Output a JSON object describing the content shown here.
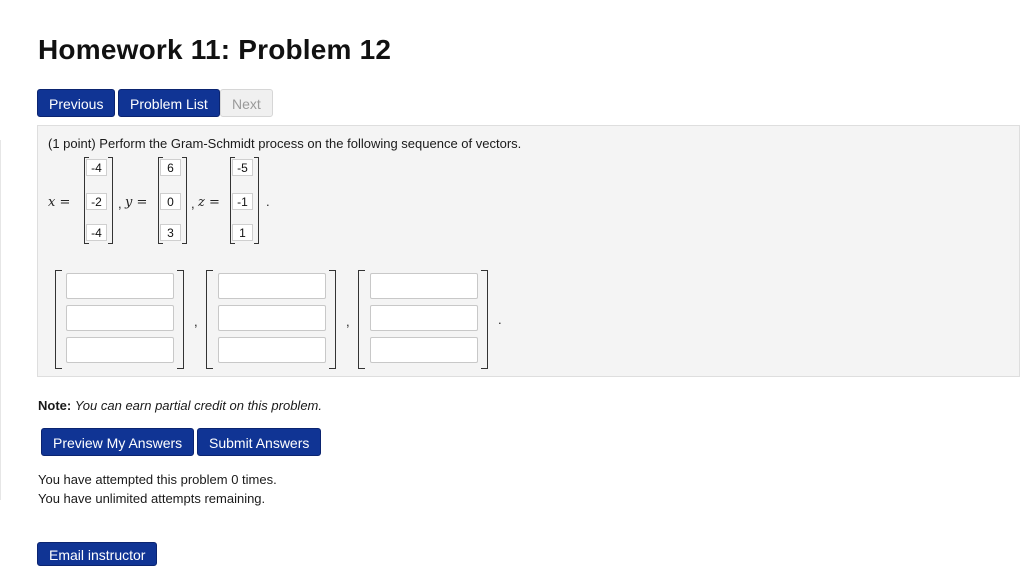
{
  "page": {
    "title": "Homework 11: Problem 12"
  },
  "nav": {
    "previous": "Previous",
    "problem_list": "Problem List",
    "next": "Next"
  },
  "problem": {
    "prompt": "(1 point) Perform the Gram-Schmidt process on the following sequence of vectors.",
    "vectors": [
      {
        "name": "x =",
        "values": [
          "-4",
          "-2",
          "-4"
        ],
        "separator": ","
      },
      {
        "name": "y =",
        "values": [
          "6",
          "0",
          "3"
        ],
        "separator": ","
      },
      {
        "name": "z =",
        "values": [
          "-5",
          "-1",
          "1"
        ],
        "separator": "."
      }
    ],
    "answer_separators": [
      ",",
      ",",
      "."
    ],
    "answer_values": [
      "",
      "",
      "",
      "",
      "",
      "",
      "",
      "",
      ""
    ]
  },
  "note": {
    "label": "Note:",
    "text": "You can earn partial credit on this problem."
  },
  "actions": {
    "preview": "Preview My Answers",
    "submit": "Submit Answers"
  },
  "status": {
    "attempted": "You have attempted this problem 0 times.",
    "remaining": "You have unlimited attempts remaining."
  },
  "footer": {
    "email": "Email instructor"
  },
  "colors": {
    "button_primary": "#103494",
    "button_disabled": "#f0f0f0",
    "panel_bg": "#f4f4f4"
  }
}
